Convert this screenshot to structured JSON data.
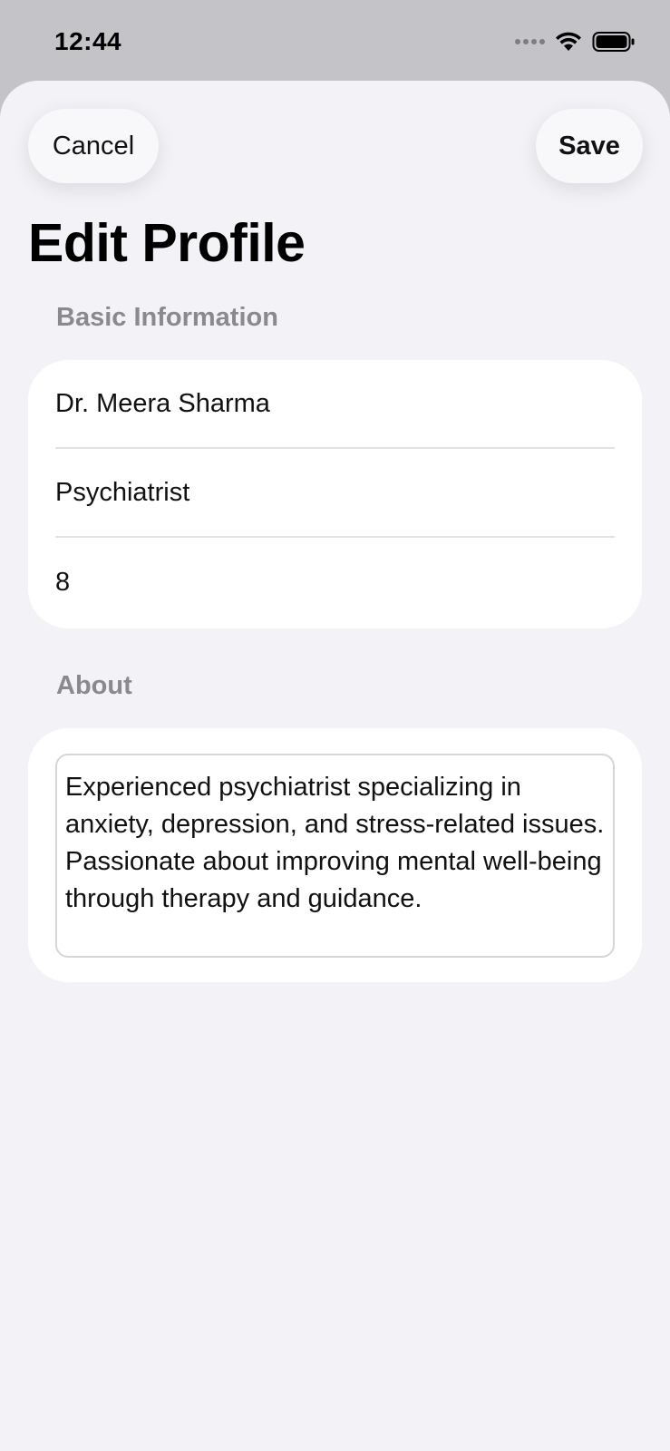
{
  "status_bar": {
    "time": "12:44",
    "icons": [
      "cellular-signal-icon",
      "wifi-icon",
      "battery-icon"
    ]
  },
  "nav": {
    "cancel_label": "Cancel",
    "save_label": "Save"
  },
  "page": {
    "title": "Edit Profile"
  },
  "basic_info": {
    "header": "Basic Information",
    "name": "Dr. Meera Sharma",
    "specialty": "Psychiatrist",
    "experience": "8"
  },
  "about": {
    "header": "About",
    "text": "Experienced psychiatrist specializing in anxiety, depression, and stress-related issues. Passionate about improving mental well-being through therapy and guidance."
  },
  "colors": {
    "background": "#f2f2f7",
    "card": "#ffffff",
    "section_header": "#8a8a8e",
    "status_bar": "#c4c4c8"
  }
}
